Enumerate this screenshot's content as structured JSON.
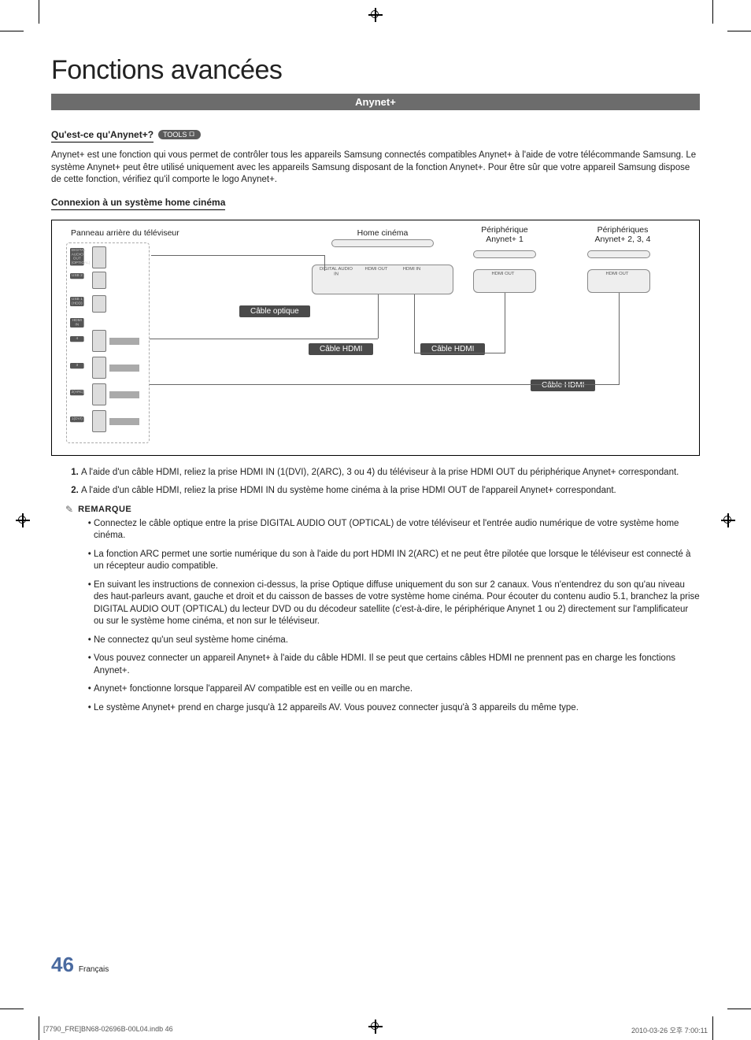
{
  "page_title": "Fonctions avancées",
  "section_bar": "Anynet+",
  "q_heading": "Qu'est-ce qu'Anynet+?",
  "tools_label": "TOOLS",
  "intro_paragraph": "Anynet+ est une fonction qui vous permet de contrôler tous les appareils Samsung connectés compatibles Anynet+ à l'aide de votre télécommande Samsung. Le système Anynet+ peut être utilisé uniquement avec les appareils Samsung disposant de la fonction Anynet+. Pour être sûr que votre appareil Samsung dispose de cette fonction, vérifiez qu'il comporte le logo Anynet+.",
  "connect_heading": "Connexion à un système home cinéma",
  "diagram": {
    "tv_panel": "Panneau arrière du téléviseur",
    "home_cinema": "Home cinéma",
    "device1": "Périphérique Anynet+ 1",
    "devices234": "Périphériques Anynet+ 2, 3, 4",
    "cable_optical": "Câble optique",
    "cable_hdmi_1": "Câble HDMI",
    "cable_hdmi_2": "Câble HDMI",
    "cable_hdmi_3": "Câble HDMI",
    "tv_ports": {
      "digital_audio": "DIGITAL AUDIO OUT (OPTICAL)",
      "usb2": "USB 2",
      "usb1": "USB 1 (HDD)",
      "hdmi_in": "HDMI IN",
      "p4": "4",
      "p3": "3",
      "p2": "2(ARC)",
      "p1": "1(DVI)"
    },
    "home_ports": {
      "audio_in": "DIGITAL AUDIO IN",
      "hdmi_out": "HDMI OUT",
      "hdmi_in": "HDMI IN"
    },
    "dev_port_out": "HDMI OUT"
  },
  "steps": [
    "A l'aide d'un câble HDMI, reliez la prise HDMI IN (1(DVI), 2(ARC), 3 ou 4) du téléviseur à la prise HDMI OUT du périphérique Anynet+ correspondant.",
    "A l'aide d'un câble HDMI, reliez la prise HDMI IN du système home cinéma à la prise HDMI OUT de l'appareil Anynet+ correspondant."
  ],
  "step1_bold": "HDMI IN (1(DVI), 2(ARC),",
  "remark_label": "REMARQUE",
  "remarks": [
    "Connectez le câble optique entre la prise DIGITAL AUDIO OUT (OPTICAL) de votre téléviseur et l'entrée audio numérique de votre système home cinéma.",
    "La fonction ARC permet une sortie numérique du son à l'aide du port HDMI IN 2(ARC) et ne peut être pilotée que lorsque le téléviseur est connecté à un récepteur audio compatible.",
    "En suivant les instructions de connexion ci-dessus, la prise Optique diffuse uniquement du son sur 2 canaux. Vous n'entendrez du son qu'au niveau des haut-parleurs avant, gauche et droit et du caisson de basses de votre système home cinéma. Pour écouter du contenu audio 5.1, branchez la prise DIGITAL AUDIO OUT (OPTICAL) du lecteur DVD ou du décodeur satellite (c'est-à-dire, le périphérique Anynet 1 ou 2) directement sur l'amplificateur ou sur le système home cinéma, et non sur le téléviseur.",
    "Ne connectez qu'un seul système home cinéma.",
    "Vous pouvez connecter un appareil Anynet+ à l'aide du câble HDMI. Il se peut que certains câbles HDMI ne prennent pas en charge les fonctions Anynet+.",
    "Anynet+ fonctionne lorsque l'appareil AV compatible est en veille ou en marche.",
    "Le système Anynet+ prend en charge jusqu'à 12 appareils AV. Vous pouvez connecter jusqu'à 3 appareils du même type."
  ],
  "footer": {
    "page_number": "46",
    "lang": "Français",
    "print_left": "[7790_FRE]BN68-02696B-00L04.indb   46",
    "print_right": "2010-03-26   오후 7:00:11"
  }
}
